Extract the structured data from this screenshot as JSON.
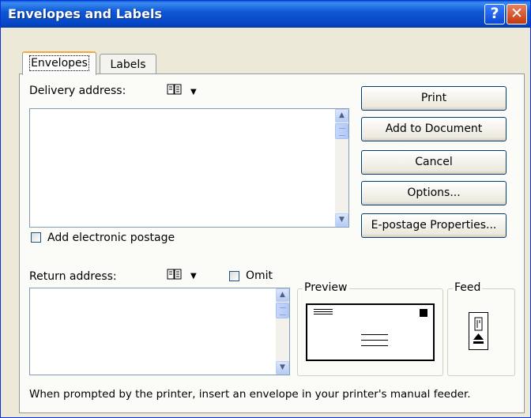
{
  "window": {
    "title": "Envelopes and Labels",
    "help_glyph": "?",
    "close_glyph": "✕"
  },
  "tabs": [
    {
      "label": "Envelopes",
      "active": true
    },
    {
      "label": "Labels",
      "active": false
    }
  ],
  "delivery": {
    "label": "Delivery address:",
    "book_icon": "address-book-icon",
    "value": ""
  },
  "postage": {
    "label": "Add electronic postage",
    "checked": false
  },
  "return_addr": {
    "label": "Return address:",
    "value": ""
  },
  "omit": {
    "label": "Omit",
    "checked": false
  },
  "buttons": {
    "print": "Print",
    "add_to_document": "Add to Document",
    "cancel": "Cancel",
    "options": "Options...",
    "epostage": "E-postage Properties..."
  },
  "preview": {
    "title": "Preview"
  },
  "feed": {
    "title": "Feed"
  },
  "hint": "When prompted by the printer, insert an envelope in your printer's manual feeder.",
  "colors": {
    "titlebar": "#0646c4",
    "dialog_bg": "#ece9d8",
    "tab_highlight": "#f1a93c"
  }
}
